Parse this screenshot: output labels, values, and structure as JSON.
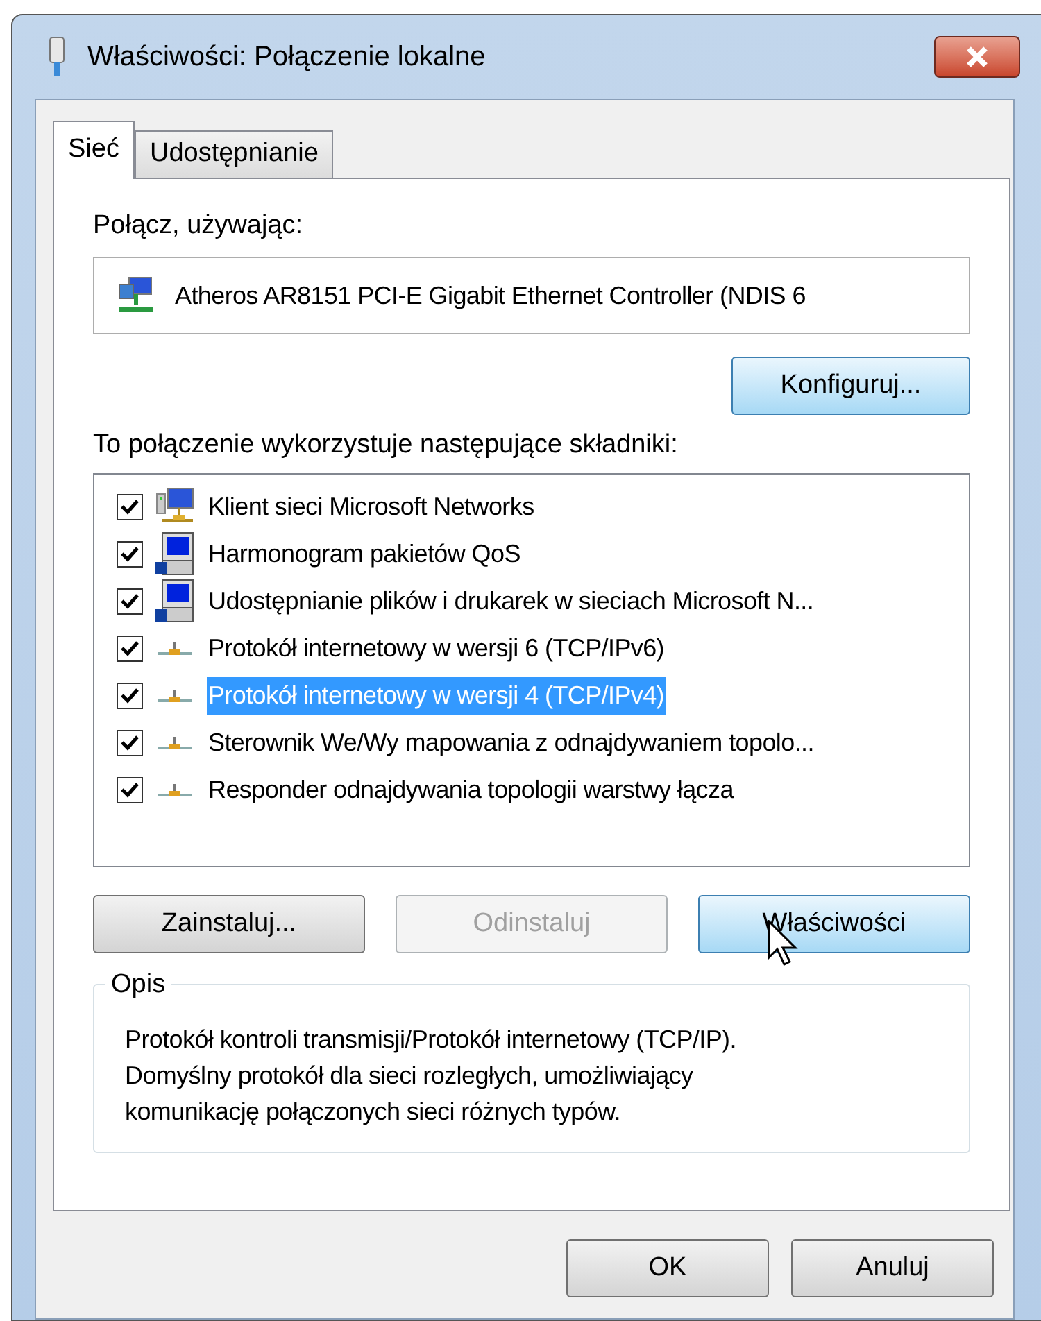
{
  "window": {
    "title": "Właściwości: Połączenie lokalne"
  },
  "tabs": [
    {
      "label": "Sieć",
      "selected": true
    },
    {
      "label": "Udostępnianie",
      "selected": false
    }
  ],
  "connect_using": {
    "label": "Połącz, używając:",
    "adapter": "Atheros AR8151 PCI-E Gigabit Ethernet Controller (NDIS 6",
    "configure_button": {
      "label": "Konfiguruj...",
      "hot": true,
      "disabled": false
    }
  },
  "components": {
    "label": "To połączenie wykorzystuje następujące składniki:",
    "items": [
      {
        "kind": "client",
        "label": "Klient sieci Microsoft Networks",
        "checked": true,
        "selected": false
      },
      {
        "kind": "service",
        "label": "Harmonogram pakietów QoS",
        "checked": true,
        "selected": false
      },
      {
        "kind": "service",
        "label": "Udostępnianie plików i drukarek w sieciach Microsoft N...",
        "checked": true,
        "selected": false
      },
      {
        "kind": "protocol",
        "label": "Protokół internetowy w wersji 6 (TCP/IPv6)",
        "checked": true,
        "selected": false
      },
      {
        "kind": "protocol",
        "label": "Protokół internetowy w wersji 4 (TCP/IPv4)",
        "checked": true,
        "selected": true
      },
      {
        "kind": "protocol",
        "label": "Sterownik We/Wy mapowania z odnajdywaniem topolo...",
        "checked": true,
        "selected": false
      },
      {
        "kind": "protocol",
        "label": "Responder odnajdywania topologii warstwy łącza",
        "checked": true,
        "selected": false
      }
    ]
  },
  "action_buttons": [
    {
      "label": "Zainstaluj...",
      "hot": false,
      "disabled": false
    },
    {
      "label": "Odinstaluj",
      "disabled": true
    },
    {
      "label": "Właściwości",
      "hot": true,
      "disabled": false
    }
  ],
  "description": {
    "title": "Opis",
    "lines": [
      "Protokół kontroli transmisji/Protokół internetowy (TCP/IP).",
      "Domyślny protokół dla sieci rozległych, umożliwiający",
      "komunikację połączonych sieci różnych typów."
    ]
  },
  "dialog_buttons": [
    {
      "label": "OK",
      "hot": false,
      "disabled": false
    },
    {
      "label": "Anuluj",
      "hot": false,
      "disabled": false
    }
  ]
}
